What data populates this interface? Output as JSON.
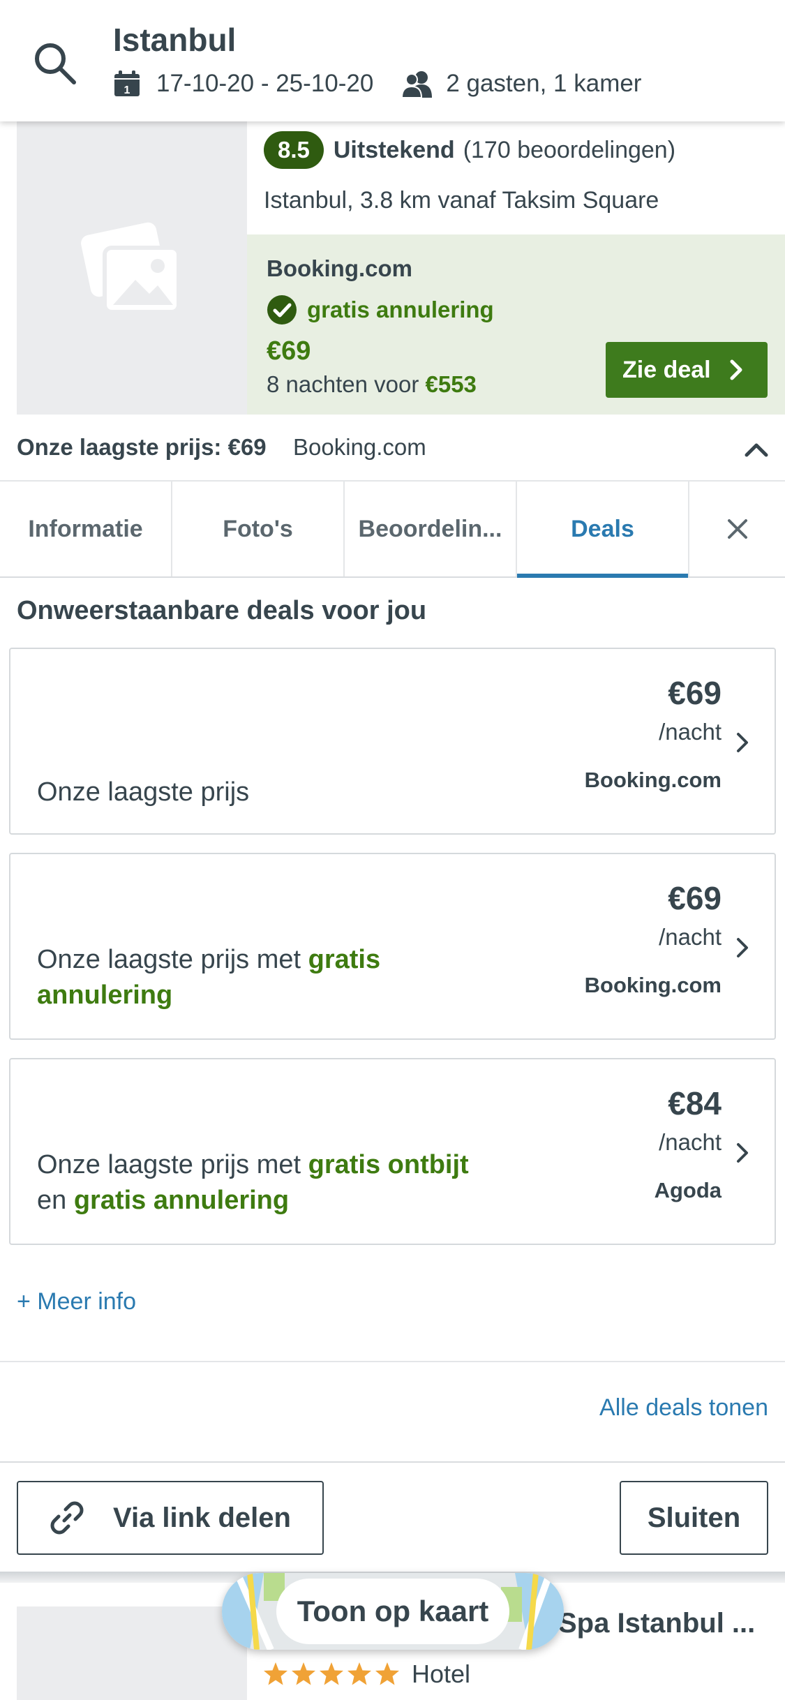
{
  "header": {
    "city": "Istanbul",
    "dates": "17-10-20 - 25-10-20",
    "guests": "2 gasten, 1 kamer"
  },
  "hotel": {
    "rating": "8.5",
    "rating_word": "Uitstekend",
    "reviews": "(170 beoordelingen)",
    "location": "Istanbul, 3.8 km vanaf Taksim Square",
    "deal": {
      "provider": "Booking.com",
      "free_cancel": "gratis annulering",
      "price": "€69",
      "nights_prefix": "8 nachten voor ",
      "nights_total": "€553",
      "button": "Zie deal"
    },
    "lowest_label": "Onze laagste prijs: €69",
    "lowest_provider": "Booking.com"
  },
  "tabs": [
    {
      "label": "Informatie"
    },
    {
      "label": "Foto's"
    },
    {
      "label": "Beoordelin..."
    },
    {
      "label": "Deals",
      "active": true
    }
  ],
  "deals_section": {
    "title": "Onweerstaanbare deals voor jou",
    "cards": [
      {
        "desc_1": "Onze laagste prijs",
        "price": "€69",
        "per": "/nacht",
        "provider": "Booking.com"
      },
      {
        "desc_1": "Onze laagste prijs met ",
        "desc_2": "gratis annulering",
        "price": "€69",
        "per": "/nacht",
        "provider": "Booking.com"
      },
      {
        "desc_1": "Onze laagste prijs met ",
        "desc_2": "gratis ontbijt",
        "desc_3": " en ",
        "desc_4": "gratis annulering",
        "price": "€84",
        "per": "/nacht",
        "provider": "Agoda"
      }
    ],
    "more_info": "+ Meer info",
    "all_deals": "Alle deals tonen"
  },
  "actions": {
    "share": "Via link delen",
    "close": "Sluiten"
  },
  "next_hotel": {
    "title": "Spa Istanbul ...",
    "type": "Hotel",
    "stars": 5
  },
  "map_button": "Toon op kaart",
  "colors": {
    "accent_blue": "#2a7ab0",
    "deal_green": "#3e7b10",
    "deal_bg": "#e8efe2",
    "rating_green": "#2f5b10",
    "text": "#37454d",
    "star": "#f0a236"
  }
}
